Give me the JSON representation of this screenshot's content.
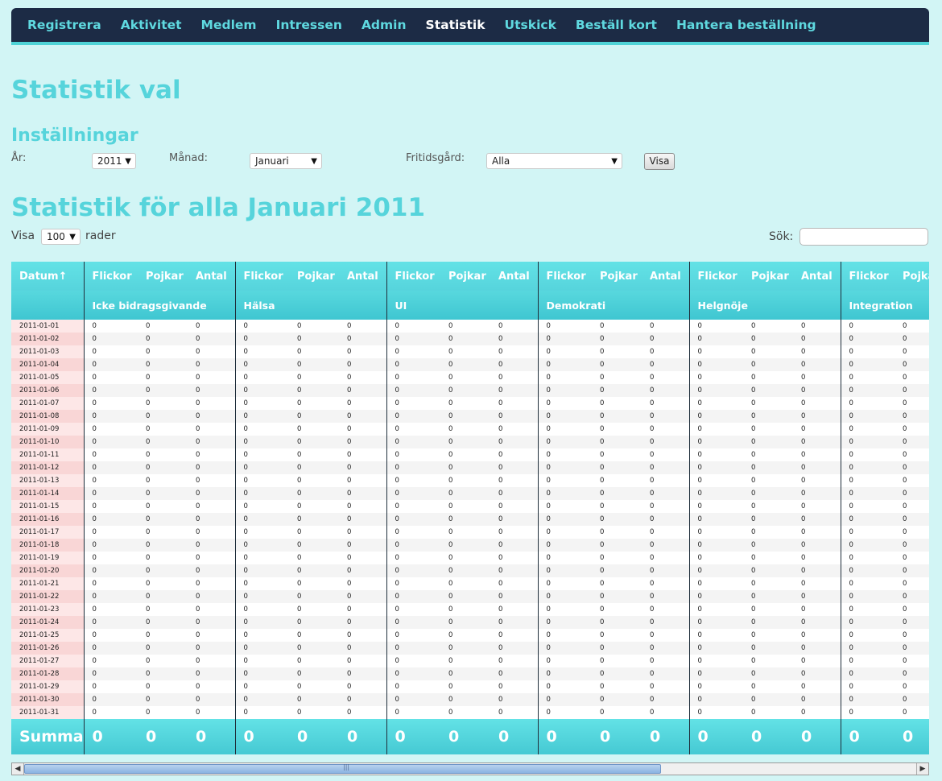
{
  "nav": {
    "items": [
      {
        "label": "Registrera",
        "active": false
      },
      {
        "label": "Aktivitet",
        "active": false
      },
      {
        "label": "Medlem",
        "active": false
      },
      {
        "label": "Intressen",
        "active": false
      },
      {
        "label": "Admin",
        "active": false
      },
      {
        "label": "Statistik",
        "active": true
      },
      {
        "label": "Utskick",
        "active": false
      },
      {
        "label": "Beställ kort",
        "active": false
      },
      {
        "label": "Hantera beställning",
        "active": false
      }
    ]
  },
  "page": {
    "title": "Statistik val",
    "settings_heading": "Inställningar",
    "stats_heading": "Statistik för alla Januari 2011"
  },
  "settings": {
    "year_label": "År:",
    "year_value": "2011",
    "month_label": "Månad:",
    "month_value": "Januari",
    "center_label": "Fritidsgård:",
    "center_value": "Alla",
    "show_button": "Visa"
  },
  "table_controls": {
    "show_label": "Visa",
    "rows_value": "100",
    "rows_suffix": "rader",
    "search_label": "Sök:",
    "search_value": ""
  },
  "table": {
    "date_header": "Datum↑",
    "sub_headers": [
      "Flickor",
      "Pojkar",
      "Antal"
    ],
    "groups": [
      "Icke bidragsgivande",
      "Hälsa",
      "UI",
      "Demokrati",
      "Helgnöje",
      "Integration"
    ],
    "dates": [
      "2011-01-01",
      "2011-01-02",
      "2011-01-03",
      "2011-01-04",
      "2011-01-05",
      "2011-01-06",
      "2011-01-07",
      "2011-01-08",
      "2011-01-09",
      "2011-01-10",
      "2011-01-11",
      "2011-01-12",
      "2011-01-13",
      "2011-01-14",
      "2011-01-15",
      "2011-01-16",
      "2011-01-17",
      "2011-01-18",
      "2011-01-19",
      "2011-01-20",
      "2011-01-21",
      "2011-01-22",
      "2011-01-23",
      "2011-01-24",
      "2011-01-25",
      "2011-01-26",
      "2011-01-27",
      "2011-01-28",
      "2011-01-29",
      "2011-01-30",
      "2011-01-31"
    ],
    "cell_value": "0",
    "footer_label": "Summa",
    "footer_value": "0"
  },
  "colors": {
    "nav_bg": "#1c2b45",
    "accent": "#56d4db",
    "page_bg": "#d2f5f5"
  },
  "icons": {
    "select_arrow": "dropdown-arrow-icon",
    "scroll_left": "scroll-left-arrow-icon",
    "scroll_right": "scroll-right-arrow-icon"
  }
}
